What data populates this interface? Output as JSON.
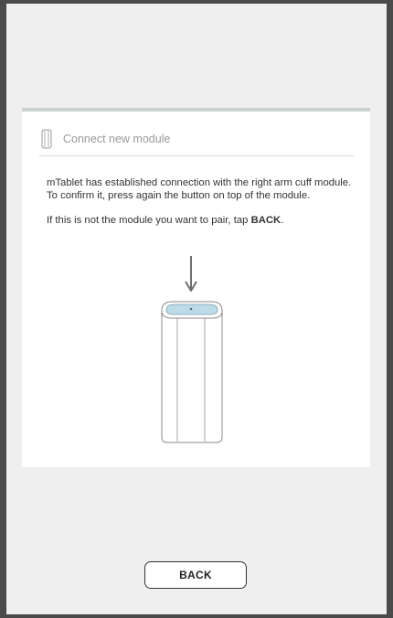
{
  "dialog": {
    "title": "Connect new module",
    "icon": "module-cylinder-icon",
    "message_line1": "mTablet has established connection with the right arm cuff module.",
    "message_line2": "To confirm it, press again the button on top of the module.",
    "message_line3_prefix": "If this is not the module you want to pair, tap ",
    "message_line3_emphasis": "BACK",
    "message_line3_suffix": ".",
    "illustration": {
      "icon": "module-device-illustration",
      "arrow_icon": "down-arrow-icon",
      "button_color": "#bcdbe9"
    }
  },
  "footer": {
    "back_label": "BACK"
  },
  "colors": {
    "frame": "#4b4b4b",
    "background": "#efefef",
    "card": "#ffffff",
    "card_accent": "#c9d4cf",
    "title_text": "#9a9a9a"
  }
}
